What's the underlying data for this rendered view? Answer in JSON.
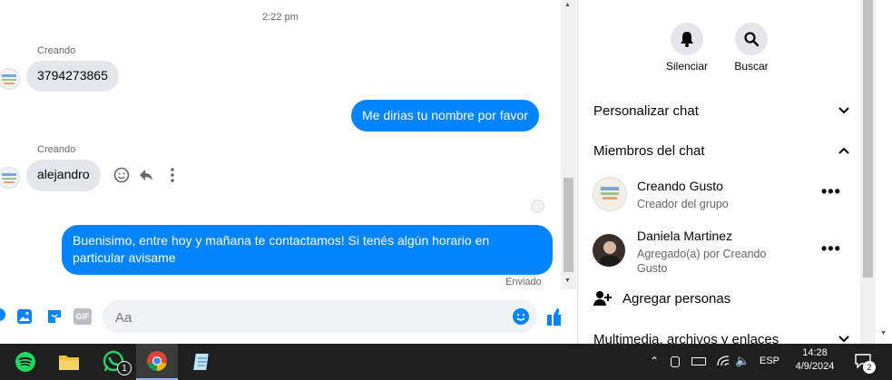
{
  "chat": {
    "timestamp": "2:22 pm",
    "messages": [
      {
        "direction": "in",
        "sender": "Creando",
        "text": "3794273865"
      },
      {
        "direction": "out",
        "text": "Me dirias tu nombre por favor"
      },
      {
        "direction": "in",
        "sender": "Creando",
        "text": "alejandro"
      },
      {
        "direction": "out",
        "text_line1": "Buenisimo, entre hoy y mañana te contactamos! Si tenés algún horario en",
        "text_line2": "particular avisame"
      }
    ],
    "status": "Enviado",
    "composer": {
      "placeholder": "Aa"
    }
  },
  "info_panel": {
    "actions": [
      {
        "label": "Silenciar",
        "icon": "bell-icon"
      },
      {
        "label": "Buscar",
        "icon": "search-icon"
      }
    ],
    "sections": {
      "customize": "Personalizar chat",
      "members": "Miembros del chat",
      "media": "Multimedia, archivos y enlaces"
    },
    "members": [
      {
        "name": "Creando Gusto",
        "subtitle": "Creador del grupo"
      },
      {
        "name": "Daniela Martinez",
        "subtitle_line1": "Agregado(a) por Creando",
        "subtitle_line2": "Gusto"
      }
    ],
    "add_people": "Agregar personas"
  },
  "taskbar": {
    "apps": [
      "spotify",
      "file-explorer",
      "whatsapp",
      "chrome",
      "notepad"
    ],
    "whatsapp_badge": "1",
    "language": "ESP",
    "time": "14:28",
    "date": "4/9/2024",
    "notifications_count": "2"
  },
  "colors": {
    "accent": "#0084ff",
    "bubble_in": "#e4e6eb",
    "taskbar": "#1f1f1f"
  }
}
